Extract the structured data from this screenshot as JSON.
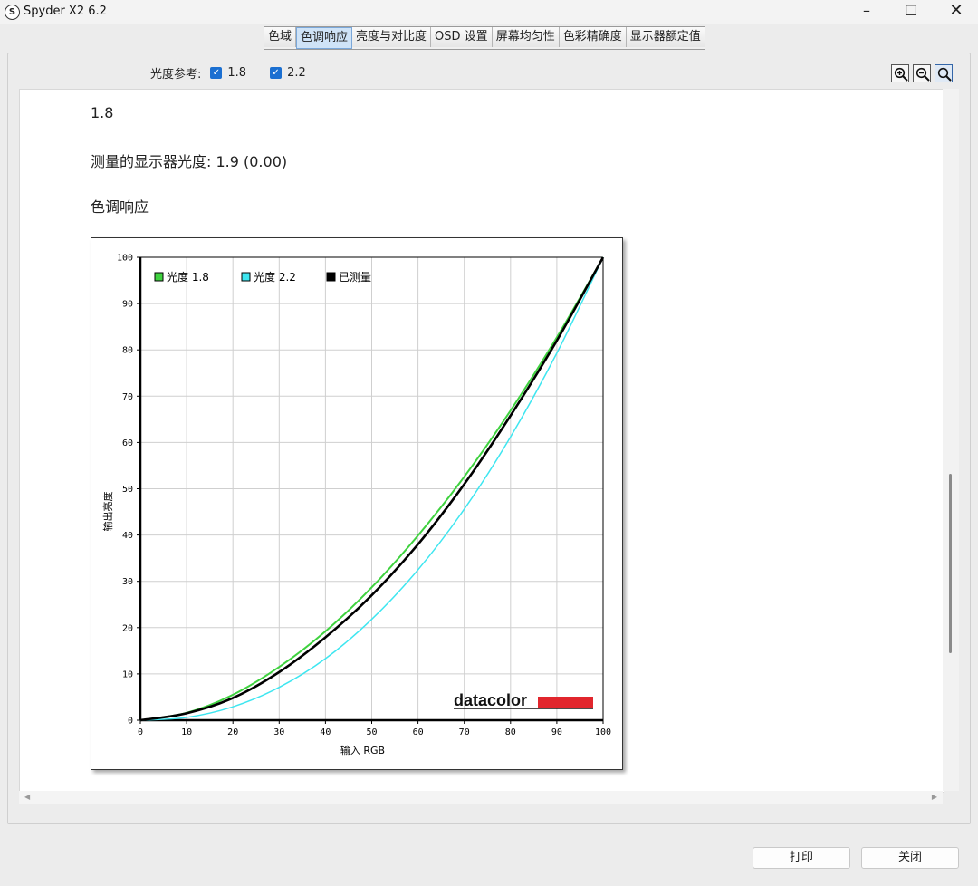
{
  "window": {
    "title": "Spyder X2 6.2",
    "app_icon": "S"
  },
  "tabs": [
    {
      "label": "色域",
      "active": false
    },
    {
      "label": "色调响应",
      "active": true
    },
    {
      "label": "亮度与对比度",
      "active": false
    },
    {
      "label": "OSD 设置",
      "active": false
    },
    {
      "label": "屏幕均匀性",
      "active": false
    },
    {
      "label": "色彩精确度",
      "active": false
    },
    {
      "label": "显示器额定值",
      "active": false
    }
  ],
  "reference": {
    "label": "光度参考:",
    "options": [
      {
        "value": "1.8",
        "checked": true
      },
      {
        "value": "2.2",
        "checked": true
      }
    ]
  },
  "zoom_icons": [
    "zoom-in-icon",
    "zoom-out-icon",
    "zoom-fit-icon"
  ],
  "report": {
    "gamma_heading": "1.8",
    "measured": "测量的显示器光度: 1.9 (0.00)",
    "section_title": "色调响应"
  },
  "chart_data": {
    "type": "line",
    "xlabel": "输入 RGB",
    "ylabel": "输出亮度",
    "xlim": [
      0,
      100
    ],
    "ylim": [
      0,
      100
    ],
    "xticks": [
      0,
      10,
      20,
      30,
      40,
      50,
      60,
      70,
      80,
      90,
      100
    ],
    "yticks": [
      0,
      10,
      20,
      30,
      40,
      50,
      60,
      70,
      80,
      90,
      100
    ],
    "grid": true,
    "legend_position": "top-left",
    "logo_text": "datacolor",
    "series": [
      {
        "name": "光度 1.8",
        "color": "#3fd23f",
        "x": [
          0,
          10,
          20,
          30,
          40,
          50,
          60,
          70,
          80,
          90,
          100
        ],
        "y": [
          0,
          1.6,
          5.5,
          11.5,
          19.2,
          28.7,
          39.9,
          52.6,
          66.9,
          82.7,
          100
        ]
      },
      {
        "name": "光度 2.2",
        "color": "#3ee6f0",
        "x": [
          0,
          10,
          20,
          30,
          40,
          50,
          60,
          70,
          80,
          90,
          100
        ],
        "y": [
          0,
          0.6,
          2.9,
          7.1,
          13.3,
          21.8,
          32.5,
          45.6,
          61.2,
          79.3,
          100
        ]
      },
      {
        "name": "已测量",
        "color": "#000000",
        "x": [
          0,
          10,
          20,
          30,
          40,
          50,
          60,
          70,
          80,
          90,
          100
        ],
        "y": [
          0,
          1.5,
          4.8,
          10.4,
          17.9,
          27.0,
          38.0,
          51.0,
          65.8,
          82.0,
          100
        ]
      }
    ]
  },
  "buttons": {
    "print": "打印",
    "close": "关闭"
  }
}
